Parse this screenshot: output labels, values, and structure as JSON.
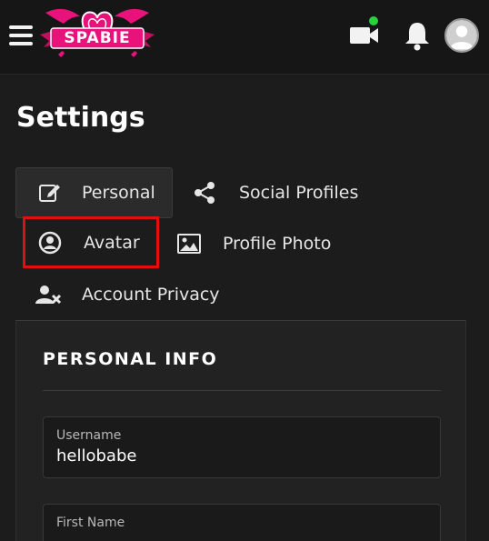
{
  "header": {
    "logo_text": "SPABIE",
    "menu_icon": "hamburger-icon",
    "video_icon": "video-camera-icon",
    "notification_icon": "bell-icon",
    "profile_icon": "user-avatar-icon",
    "online_status_color": "#27d33a",
    "brand_color": "#e8127a"
  },
  "page": {
    "title": "Settings"
  },
  "settings_menu": {
    "items": [
      {
        "label": "Personal",
        "icon": "edit-icon",
        "active": true
      },
      {
        "label": "Social Profiles",
        "icon": "share-icon"
      },
      {
        "label": "Avatar",
        "icon": "user-circle-icon",
        "highlighted": true
      },
      {
        "label": "Profile Photo",
        "icon": "image-icon"
      },
      {
        "label": "Account Privacy",
        "icon": "user-x-icon"
      }
    ]
  },
  "personal_info": {
    "section_title": "PERSONAL INFO",
    "fields": [
      {
        "label": "Username",
        "value": "hellobabe"
      },
      {
        "label": "First Name",
        "value": ""
      }
    ]
  },
  "colors": {
    "background": "#1c1c1c",
    "highlight_border": "#e01010"
  }
}
